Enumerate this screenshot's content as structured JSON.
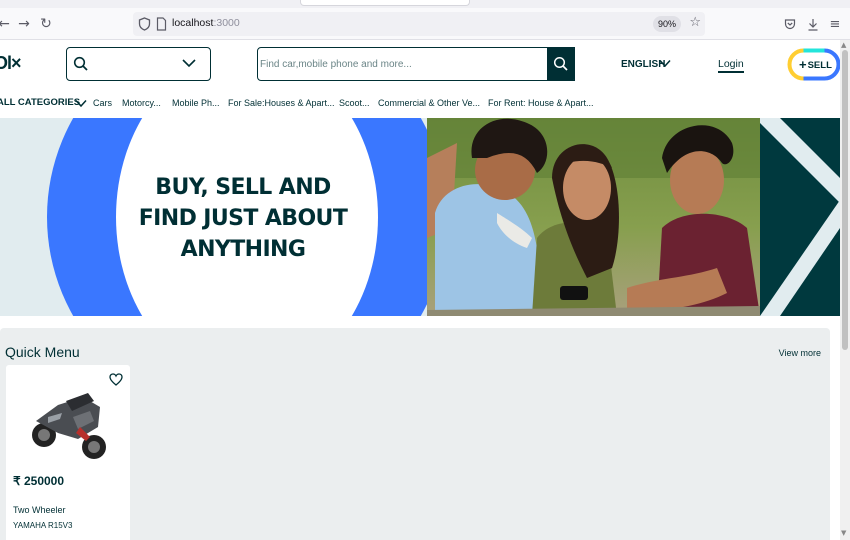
{
  "browser": {
    "url_host": "localhost",
    "url_port": ":3000",
    "zoom": "90%"
  },
  "header": {
    "logo": "Ol×",
    "location_placeholder": "",
    "search_placeholder": "Find car,mobile phone and more...",
    "language": "ENGLISH",
    "login": "Login",
    "sell": "SELL",
    "sell_plus": "+"
  },
  "categories": {
    "all": "ALL CATEGORIES",
    "items": [
      "Cars",
      "Motorcy...",
      "Mobile Ph...",
      "For Sale:Houses & Apart...",
      "Scoot...",
      "Commercial & Other Ve...",
      "For Rent: House & Apart..."
    ]
  },
  "banner": {
    "line1": "BUY, SELL AND",
    "line2": "FIND JUST ABOUT",
    "line3": "ANYTHING",
    "colors": {
      "blue": "#3a77ff",
      "dark": "#00393e",
      "cream": "#e1ecef"
    }
  },
  "quick_menu": {
    "title": "Quick Menu",
    "view_more": "View more",
    "cards": [
      {
        "price": "₹ 250000",
        "category": "Two Wheeler",
        "model": "YAMAHA R15V3",
        "image_icon": "motorcycle-icon"
      }
    ]
  }
}
